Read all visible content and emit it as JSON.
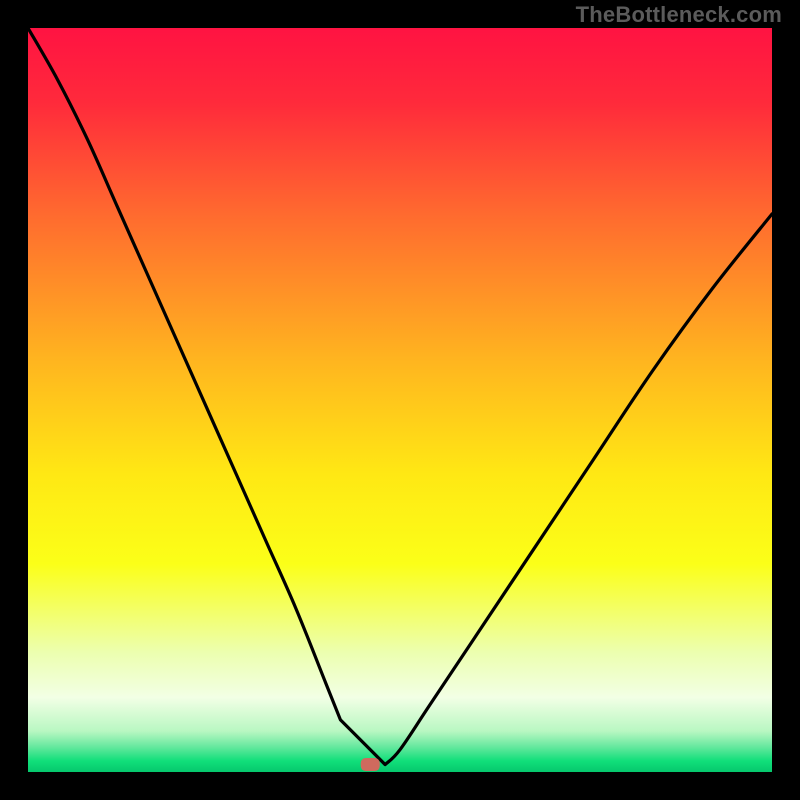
{
  "watermark": "TheBottleneck.com",
  "chart_data": {
    "type": "line",
    "title": "",
    "xlabel": "",
    "ylabel": "",
    "xlim": [
      0,
      100
    ],
    "ylim": [
      0,
      100
    ],
    "series": [
      {
        "name": "curve",
        "x": [
          0,
          4,
          8,
          12,
          16,
          20,
          24,
          28,
          32,
          36,
          40,
          42,
          44,
          45,
          46,
          48,
          50,
          54,
          60,
          68,
          76,
          84,
          92,
          100
        ],
        "y": [
          100,
          93,
          85,
          76,
          67,
          58,
          49,
          40,
          31,
          22,
          12,
          7,
          3,
          1,
          1,
          1,
          3,
          9,
          18,
          30,
          42,
          54,
          65,
          75
        ]
      }
    ],
    "marker": {
      "x": 46,
      "y": 1,
      "color": "#cf6a5e"
    },
    "plateau": {
      "x_start": 42.5,
      "x_end": 48,
      "y": 1
    },
    "background_gradient": {
      "stops": [
        {
          "offset": 0.0,
          "color": "#ff1342"
        },
        {
          "offset": 0.1,
          "color": "#ff2a3b"
        },
        {
          "offset": 0.25,
          "color": "#ff6a2f"
        },
        {
          "offset": 0.45,
          "color": "#ffb61f"
        },
        {
          "offset": 0.6,
          "color": "#ffe814"
        },
        {
          "offset": 0.72,
          "color": "#fbff18"
        },
        {
          "offset": 0.84,
          "color": "#ecffb0"
        },
        {
          "offset": 0.9,
          "color": "#f2ffe5"
        },
        {
          "offset": 0.945,
          "color": "#b9f7c2"
        },
        {
          "offset": 0.965,
          "color": "#6ae9a0"
        },
        {
          "offset": 0.985,
          "color": "#11df7a"
        },
        {
          "offset": 1.0,
          "color": "#06c86d"
        }
      ]
    }
  }
}
